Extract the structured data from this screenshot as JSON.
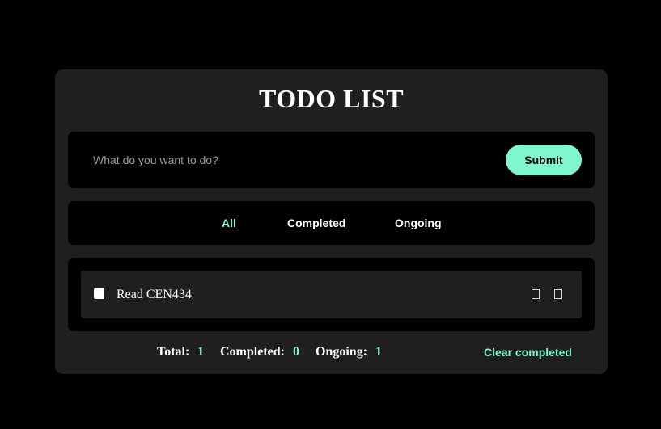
{
  "app": {
    "title": "TODO LIST"
  },
  "input": {
    "value": "",
    "placeholder": "What do you want to do?",
    "submit_label": "Submit"
  },
  "filters": {
    "all": "All",
    "completed": "Completed",
    "ongoing": "Ongoing",
    "active": "All"
  },
  "todos": [
    {
      "text": "Read CEN434",
      "completed": false
    }
  ],
  "stats": {
    "total_label": "Total:",
    "total_value": "1",
    "completed_label": "Completed:",
    "completed_value": "0",
    "ongoing_label": "Ongoing:",
    "ongoing_value": "1",
    "clear_label": "Clear completed"
  },
  "colors": {
    "accent": "#7ff6cf",
    "background": "#000000",
    "card": "#1f1f1f"
  },
  "icons": {
    "edit": "edit-icon",
    "delete": "delete-icon"
  }
}
